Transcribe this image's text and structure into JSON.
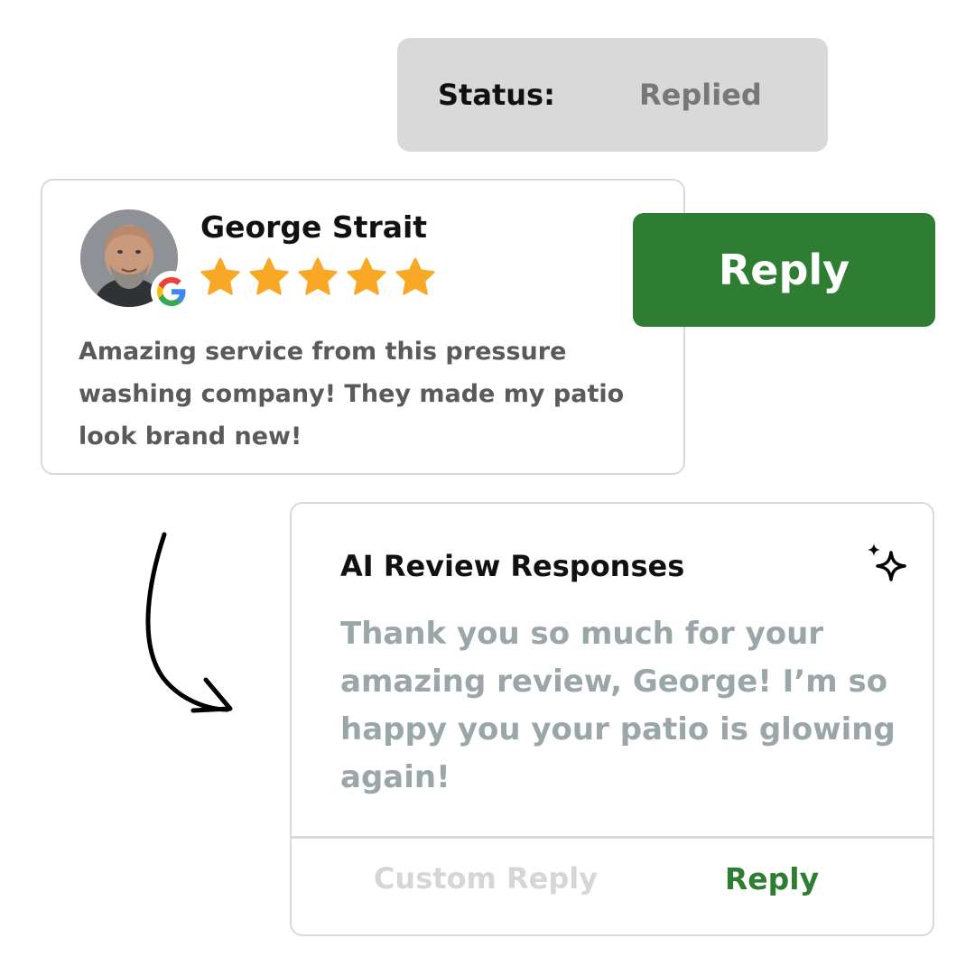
{
  "status": {
    "label": "Status:",
    "value": "Replied"
  },
  "review": {
    "reviewer_name": "George Strait",
    "rating": 5,
    "rating_max": 5,
    "source_icon": "google-icon",
    "text": "Amazing service from this pressure washing company! They made my patio look brand new!"
  },
  "reply_button": {
    "label": "Reply"
  },
  "ai_panel": {
    "title": "AI Review Responses",
    "icon": "sparkle-icon",
    "response_text": "Thank you so much for your amazing review, George! I’m so happy you your patio is glowing again!",
    "custom_reply_label": "Custom Reply",
    "reply_label": "Reply"
  },
  "colors": {
    "accent_green": "#2e7d32",
    "star": "#f9a825",
    "status_bg": "#d9d9d9",
    "border": "#d9d9d9",
    "ai_text": "#9aa6a8"
  }
}
